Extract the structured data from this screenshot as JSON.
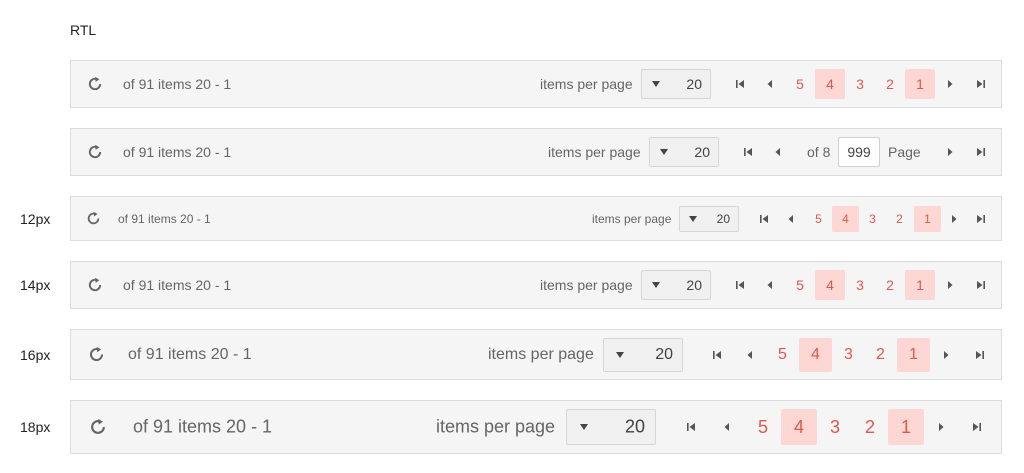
{
  "direction_label": "RTL",
  "rows": [
    {
      "size_label": "",
      "info": "of 91 items 20 - 1",
      "items_per_page": "items per page",
      "page_size": "20",
      "pages": [
        "5",
        "4",
        "3",
        "2",
        "1"
      ],
      "selected": "1",
      "hover": "4"
    },
    {
      "size_label": "",
      "info": "of 91 items 20 - 1",
      "items_per_page": "items per page",
      "page_size": "20",
      "of_pages": "of 8",
      "page_input": "999",
      "page_label": "Page"
    },
    {
      "size_label": "12px",
      "info": "of 91 items 20 - 1",
      "items_per_page": "items per page",
      "page_size": "20",
      "pages": [
        "5",
        "4",
        "3",
        "2",
        "1"
      ],
      "selected": "1",
      "hover": "4"
    },
    {
      "size_label": "14px",
      "info": "of 91 items 20 - 1",
      "items_per_page": "items per page",
      "page_size": "20",
      "pages": [
        "5",
        "4",
        "3",
        "2",
        "1"
      ],
      "selected": "1",
      "hover": "4"
    },
    {
      "size_label": "16px",
      "info": "of 91 items 20 - 1",
      "items_per_page": "items per page",
      "page_size": "20",
      "pages": [
        "5",
        "4",
        "3",
        "2",
        "1"
      ],
      "selected": "1",
      "hover": "4"
    },
    {
      "size_label": "18px",
      "info": "of 91 items 20 - 1",
      "items_per_page": "items per page",
      "page_size": "20",
      "pages": [
        "5",
        "4",
        "3",
        "2",
        "1"
      ],
      "selected": "1",
      "hover": "4"
    }
  ],
  "icons": {
    "refresh": "refresh-icon",
    "first": "first-page-icon",
    "prev": "previous-page-icon",
    "next": "next-page-icon",
    "last": "last-page-icon",
    "dropdown": "caret-down-icon"
  },
  "colors": {
    "page_number": "#e0584a",
    "selected_bg": "#fcd7d3",
    "pager_bg": "#f5f5f5"
  }
}
